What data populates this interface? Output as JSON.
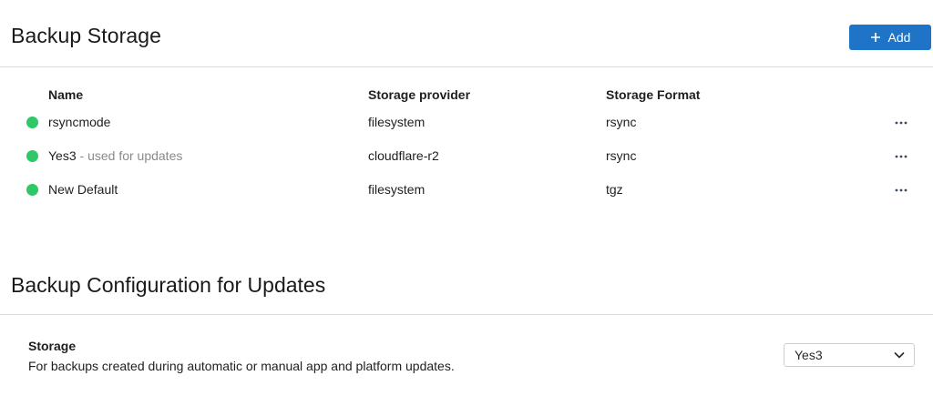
{
  "backup_storage": {
    "title": "Backup Storage",
    "add_label": "Add",
    "columns": {
      "name": "Name",
      "provider": "Storage provider",
      "format": "Storage Format"
    },
    "rows": [
      {
        "name": "rsyncmode",
        "note": "",
        "provider": "filesystem",
        "format": "rsync",
        "status": "active",
        "status_color": "#2ec866"
      },
      {
        "name": "Yes3",
        "note": " - used for updates",
        "provider": "cloudflare-r2",
        "format": "rsync",
        "status": "active",
        "status_color": "#2ec866"
      },
      {
        "name": "New Default",
        "note": "",
        "provider": "filesystem",
        "format": "tgz",
        "status": "active",
        "status_color": "#2ec866"
      }
    ]
  },
  "backup_config": {
    "title": "Backup Configuration for Updates",
    "storage_label": "Storage",
    "storage_description": "For backups created during automatic or manual app and platform updates.",
    "storage_selected": "Yes3"
  },
  "icons": {
    "add": "plus-icon",
    "row_actions": "more-horizontal-icon",
    "select": "chevron-down-icon",
    "status": "status-dot"
  },
  "colors": {
    "accent": "#1f74c7",
    "status_active": "#2ec866",
    "muted_text": "#8a8a8a",
    "divider": "#dcdcdc"
  }
}
